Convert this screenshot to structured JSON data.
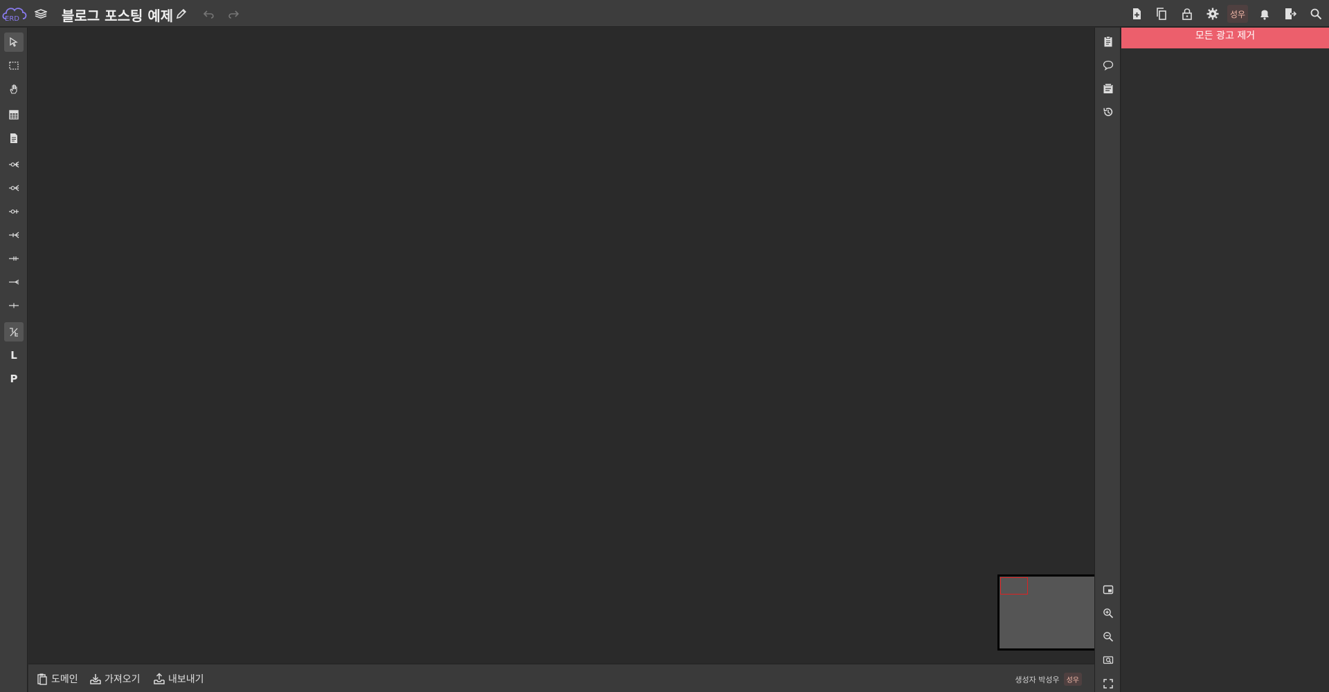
{
  "header": {
    "logo_text": "ERD",
    "title": "블로그 포스팅 예제",
    "user_initials": "성우"
  },
  "bottombar": {
    "domain_label": "도메인",
    "import_label": "가져오기",
    "export_label": "내보내기",
    "creator_label": "생성자 박성우",
    "creator_badge": "성우"
  },
  "left_toolbar": {
    "items": [
      "select",
      "area-select",
      "hand",
      "table",
      "note",
      "relation-zero-one-many",
      "relation-zero-many",
      "relation-zero-one",
      "relation-one-many",
      "relation-one-only",
      "relation-many",
      "relation-one",
      "relation-shape-toggle",
      "logical",
      "physical"
    ],
    "logical_label": "L",
    "physical_label": "P",
    "active": "relation-shape-toggle"
  },
  "ad_panel": {
    "remove_ads_label": "모든 광고 제거",
    "accent_color": "#ec5f6c"
  }
}
